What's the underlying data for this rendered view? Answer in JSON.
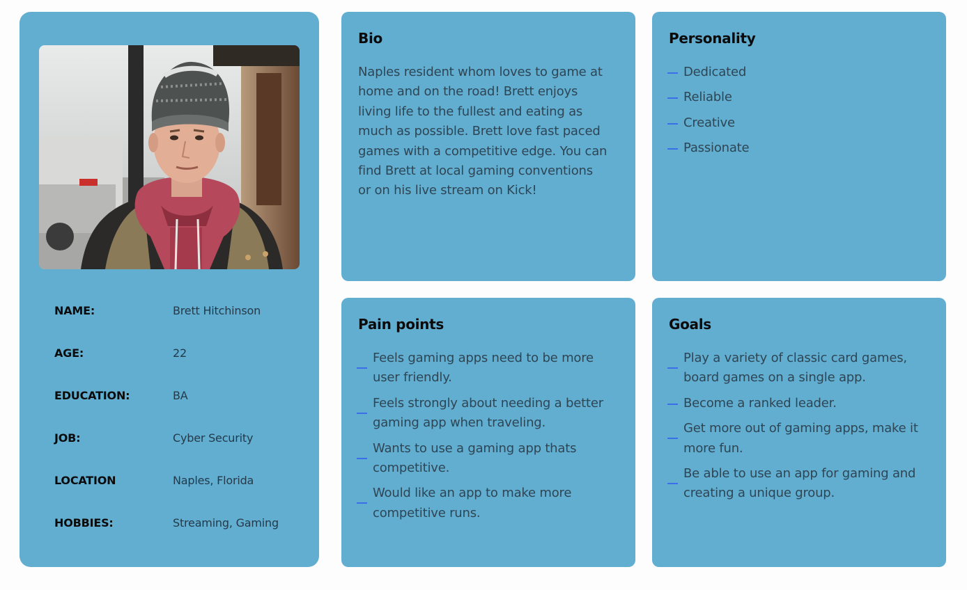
{
  "profile": {
    "photo_alt": "Portrait of a young man in a knit beanie and red hoodie",
    "rows": [
      {
        "label": "NAME:",
        "value": "Brett Hitchinson"
      },
      {
        "label": "AGE:",
        "value": "22"
      },
      {
        "label": "EDUCATION:",
        "value": "BA"
      },
      {
        "label": "JOB:",
        "value": "Cyber Security"
      },
      {
        "label": "LOCATION",
        "value": "Naples, Florida"
      },
      {
        "label": "HOBBIES:",
        "value": "Streaming, Gaming"
      }
    ]
  },
  "bio": {
    "title": "Bio",
    "text": "Naples resident whom loves to game at home and on the road! Brett enjoys living life to the fullest and eating as much as possible. Brett love fast paced games with a competitive edge. You can find Brett at local gaming conventions or on his live stream on Kick!"
  },
  "personality": {
    "title": "Personality",
    "items": [
      "Dedicated",
      "Reliable",
      "Creative",
      "Passionate"
    ]
  },
  "pain_points": {
    "title": "Pain points",
    "items": [
      "Feels gaming apps need to be more user friendly.",
      "Feels strongly about needing a better gaming app when traveling.",
      "Wants to use a gaming app thats competitive.",
      "Would like an app to make more competitive runs."
    ]
  },
  "goals": {
    "title": "Goals",
    "items": [
      "Play a variety of classic card games, board games on a single app.",
      "Become a ranked leader.",
      "Get more out of gaming apps, make it more fun.",
      "Be able to use an app for gaming and creating a unique group."
    ]
  },
  "colors": {
    "card": "#62aed1",
    "background": "#fdfdfd",
    "bullet": "#3a6fe8",
    "heading": "#0b0b0b",
    "body_text": "#2e4554"
  }
}
